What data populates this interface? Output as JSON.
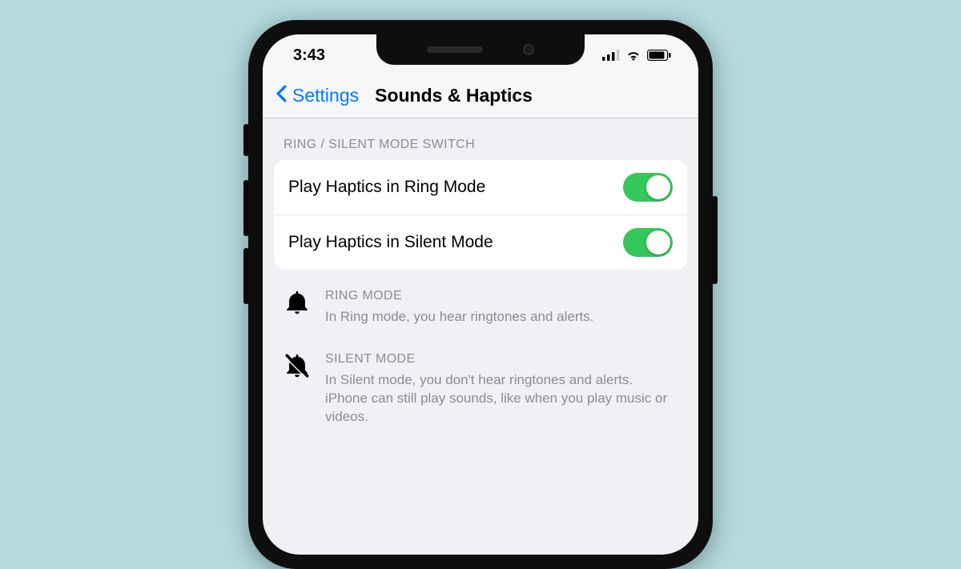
{
  "status": {
    "time": "3:43"
  },
  "nav": {
    "back_label": "Settings",
    "title": "Sounds & Haptics"
  },
  "group": {
    "header": "RING / SILENT MODE SWITCH",
    "rows": [
      {
        "label": "Play Haptics in Ring Mode",
        "value": true
      },
      {
        "label": "Play Haptics in Silent Mode",
        "value": true
      }
    ]
  },
  "info": [
    {
      "icon": "bell-icon",
      "title": "RING MODE",
      "desc": "In Ring mode, you hear ringtones and alerts."
    },
    {
      "icon": "bell-slash-icon",
      "title": "SILENT MODE",
      "desc": "In Silent mode, you don't hear ringtones and alerts. iPhone can still play sounds, like when you play music or videos."
    }
  ]
}
